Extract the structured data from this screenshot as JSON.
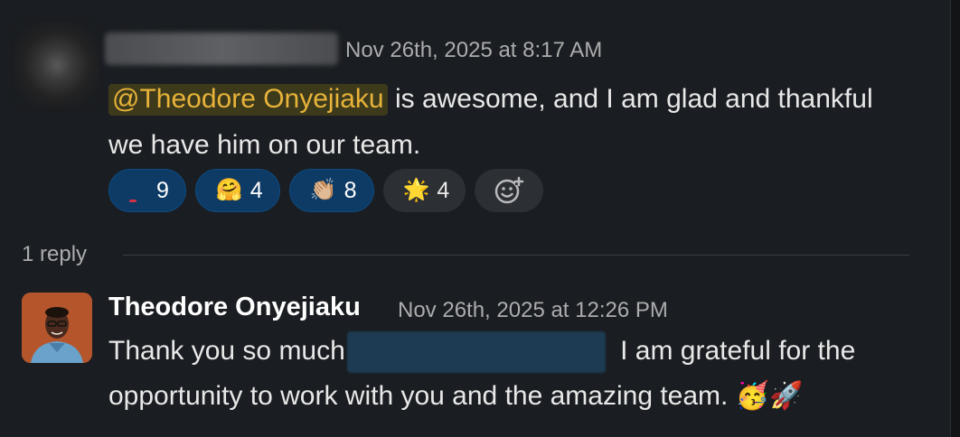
{
  "message1": {
    "timestamp": "Nov 26th, 2025 at 8:17 AM",
    "mention": "@Theodore Onyejiaku",
    "text": " is awesome, and I am glad and thankful we have him on our team.",
    "reactions": [
      {
        "emoji": "",
        "count": "9",
        "active": true
      },
      {
        "emoji": "🤗",
        "count": "4",
        "active": true
      },
      {
        "emoji": "👏🏼",
        "count": "8",
        "active": true
      },
      {
        "emoji": "🌟",
        "count": "4",
        "active": false
      }
    ],
    "add_reaction_icon": "add-emoji-icon"
  },
  "thread": {
    "reply_count": "1 reply"
  },
  "message2": {
    "author": "Theodore Onyejiaku",
    "timestamp": "Nov 26th, 2025 at 12:26 PM",
    "text_before": "Thank you so much",
    "text_after": " I am grateful for the opportunity to work with you and the amazing team. ",
    "emojis": "🥳🚀"
  },
  "colors": {
    "background": "#1a1d21",
    "mention_bg": "#3d3a1c",
    "mention_text": "#e8b339",
    "reaction_active_bg": "#0d3b66",
    "reaction_inactive_bg": "#2c2f33"
  }
}
